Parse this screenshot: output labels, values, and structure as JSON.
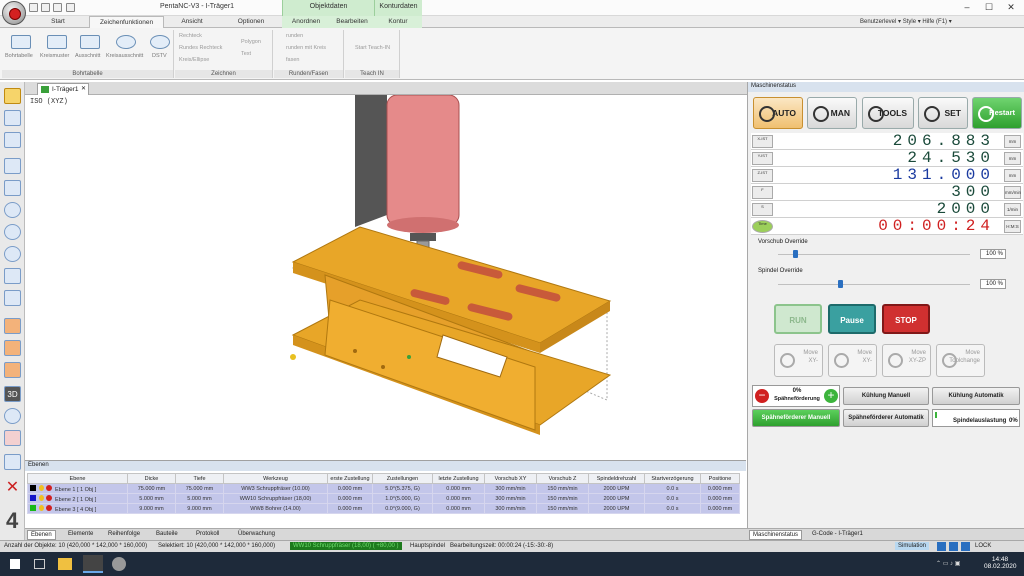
{
  "window": {
    "title": "PentaNC-V3 - I-Träger1",
    "context_tabs": [
      "Objektdaten",
      "Konturdaten"
    ],
    "min": "–",
    "max": "☐",
    "close": "✕"
  },
  "ribbon_tabs": [
    "Start",
    "Zeichenfunktionen",
    "Ansicht",
    "Optionen",
    "Anordnen",
    "Bearbeiten",
    "Kontur"
  ],
  "ribbon_right": "Benutzerlevel ▾  Style ▾  Hilfe (F1) ▾",
  "ribbon": {
    "bohrtabelle": {
      "label": "Bohrtabelle",
      "items": [
        "Bohrtabelle",
        "Kreismuster",
        "Ausschnitt",
        "Kreisausschnitt",
        "DSTV"
      ]
    },
    "zeichnen": {
      "label": "Zeichnen",
      "items": [
        "Rechteck",
        "Rundes Rechteck",
        "Kreis/Ellipse",
        "Polygon",
        "Text"
      ]
    },
    "runden": {
      "label": "Runden/Fasen",
      "items": [
        "runden",
        "runden mit Kreis",
        "fasen"
      ]
    },
    "teach": {
      "label": "Teach IN",
      "items": [
        "Start Teach-IN"
      ]
    }
  },
  "doc_tab": "I-Träger1",
  "doc_close": "✕",
  "view_label": "ISO (XYZ)",
  "machine": {
    "title": "Maschinenstatus",
    "modes": [
      "AUTO",
      "MAN",
      "TOOLS",
      "SET",
      "Restart"
    ],
    "readouts": [
      {
        "icon": "X-IST",
        "value": "206.883",
        "unit": "mm"
      },
      {
        "icon": "Y-IST",
        "value": "24.530",
        "unit": "mm"
      },
      {
        "icon": "Z-IST",
        "value": "131.000",
        "unit": "mm"
      },
      {
        "icon": "F",
        "value": "300",
        "unit": "mm/min"
      },
      {
        "icon": "S",
        "value": "2000",
        "unit": "1/min"
      },
      {
        "icon": "Time",
        "value": "00:00:24",
        "unit": "H:M:S"
      }
    ],
    "vorschub": {
      "label": "Vorschub Override",
      "value": "100 %",
      "fraction": 0.08
    },
    "spindel": {
      "label": "Spindel Override",
      "value": "100 %",
      "fraction": 0.31
    },
    "run": "RUN",
    "pause": "Pause",
    "stop": "STOP",
    "moves": [
      [
        "Move",
        "XY-"
      ],
      [
        "Move",
        "XY-"
      ],
      [
        "Move",
        "XY-ZP"
      ],
      [
        "Move",
        "Toolchange"
      ]
    ],
    "spaene_pct": "0%",
    "spaene_label": "Spähneförderung",
    "kuehl_manuell": "Kühlung Manuell",
    "kuehl_auto": "Kühlung Automatik",
    "sf_manuell": "Spähneförderer Manuell",
    "sf_auto": "Spähneförderer Automatik",
    "spindel_ausl": "Spindelauslastung",
    "spindel_ausl_pct": "0%",
    "tabs": [
      "Maschinenstatus",
      "G-Code - I-Träger1"
    ]
  },
  "ebenen": {
    "title": "Ebenen",
    "columns": [
      "Ebene",
      "Dicke",
      "Tiefe",
      "Werkzeug",
      "erste Zustellung",
      "Zustellungen",
      "letzte Zustellung",
      "Vorschub XY",
      "Vorschub Z",
      "Spindeldrehzahl",
      "Startverzögerung",
      "Positione"
    ],
    "rows": [
      {
        "color": "#000000",
        "cells": [
          "Ebene 1 [ 1 Obj ]",
          "75.000 mm",
          "75.000 mm",
          "WW3 Schruppfräser (10.00)",
          "0.000 mm",
          "5.0°(5.375, G)",
          "0.000 mm",
          "300 mm/min",
          "150 mm/min",
          "2000 UPM",
          "0.0 s",
          "0.000 mm"
        ]
      },
      {
        "color": "#1414c8",
        "cells": [
          "Ebene 2 [ 1 Obj ]",
          "5.000 mm",
          "5.000 mm",
          "WW10 Schruppfräser (18,00)",
          "0.000 mm",
          "1.0°(5.000, G)",
          "0.000 mm",
          "300 mm/min",
          "150 mm/min",
          "2000 UPM",
          "0.0 s",
          "0.000 mm"
        ]
      },
      {
        "color": "#18b818",
        "cells": [
          "Ebene 3 [ 4 Obj ]",
          "9.000 mm",
          "9.000 mm",
          "WW8 Bohrer (14.00)",
          "0.000 mm",
          "0.0°(9.000, G)",
          "0.000 mm",
          "300 mm/min",
          "150 mm/min",
          "2000 UPM",
          "0.0 s",
          "0.000 mm"
        ]
      }
    ]
  },
  "bottom_tabs": [
    "Ebenen",
    "Elemente",
    "Reihenfolge",
    "Bauteile",
    "Protokoll",
    "Überwachung"
  ],
  "status": {
    "count": "Anzahl der Objekte: 10 (420,000 * 142,000 * 160,000)",
    "selected": "Selektiert: 10 (420,000 * 142,000 * 160,000)",
    "tool": "WW10 Schruppfräser (18,00) ( +80,00 )",
    "spindle": "Hauptspindel",
    "time": "Bearbeitungszeit: 00:00:24 (-15:-30:-8)",
    "sim": "Simulation",
    "lock": "LOCK"
  },
  "taskbar": {
    "time": "14:48",
    "date": "08.02.2020"
  },
  "tool_numbers": [
    "4"
  ],
  "colors": {
    "accent": "#2a6fc0",
    "part": "#e8a628",
    "spindle": "#e58080",
    "run_green": "#7fc07f",
    "pause_teal": "#3aa0a0",
    "stop_red": "#d03030",
    "restart_green": "#3cb43c"
  }
}
